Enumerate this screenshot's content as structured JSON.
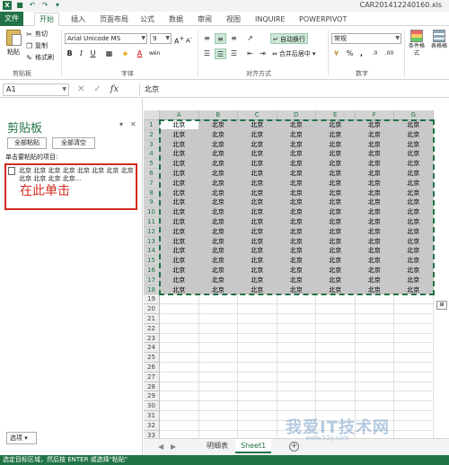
{
  "window": {
    "title": "CAR201412240160.xls"
  },
  "ribbon_tabs": [
    "文件",
    "开始",
    "插入",
    "页面布局",
    "公式",
    "数据",
    "审阅",
    "视图",
    "INQUIRE",
    "POWERPIVOT"
  ],
  "ribbon": {
    "paste": "粘贴",
    "cut": "剪切",
    "copy": "复制",
    "format_painter": "格式刷",
    "clipboard_group": "剪贴板",
    "font_name": "Arial Unicode MS",
    "font_size": "9",
    "font_group": "字体",
    "wrap_text": "自动换行",
    "merge_center": "合并后居中",
    "align_group": "对齐方式",
    "number_format": "常规",
    "number_group": "数字",
    "conditional_format": "条件格式",
    "table_format": "表格格"
  },
  "formula_bar": {
    "name_box": "A1",
    "content": "北京"
  },
  "clipboard_pane": {
    "title": "剪贴板",
    "paste_all": "全部粘贴",
    "clear_all": "全部清空",
    "hint": "单击要粘贴的项目:",
    "item_text": "北京 北京 北京 北京 北京 北京 北京 北京 北京 北京 北京 北京...",
    "annotation": "在此单击",
    "options": "选项 ▾"
  },
  "grid": {
    "columns": [
      "A",
      "B",
      "C",
      "D",
      "E",
      "F",
      "G"
    ],
    "rows": [
      "1",
      "2",
      "3",
      "4",
      "5",
      "6",
      "7",
      "8",
      "9",
      "10",
      "11",
      "12",
      "13",
      "14",
      "15",
      "16",
      "17",
      "18",
      "19",
      "20",
      "21",
      "22",
      "23",
      "24",
      "25",
      "26",
      "27",
      "28",
      "29",
      "30",
      "31",
      "32",
      "33"
    ],
    "filled_rows": 18,
    "cell_value": "北京"
  },
  "sheets": {
    "tabs": [
      "明细表",
      "Sheet1"
    ],
    "active": "Sheet1"
  },
  "status": {
    "text": "选定目标区域，然后按 ENTER 或选择\"粘贴\""
  },
  "watermark": {
    "text": "我爱IT技术网",
    "sub": "www.52ij.com"
  },
  "colors": {
    "accent": "#217346",
    "annotation": "#d32b1e"
  }
}
